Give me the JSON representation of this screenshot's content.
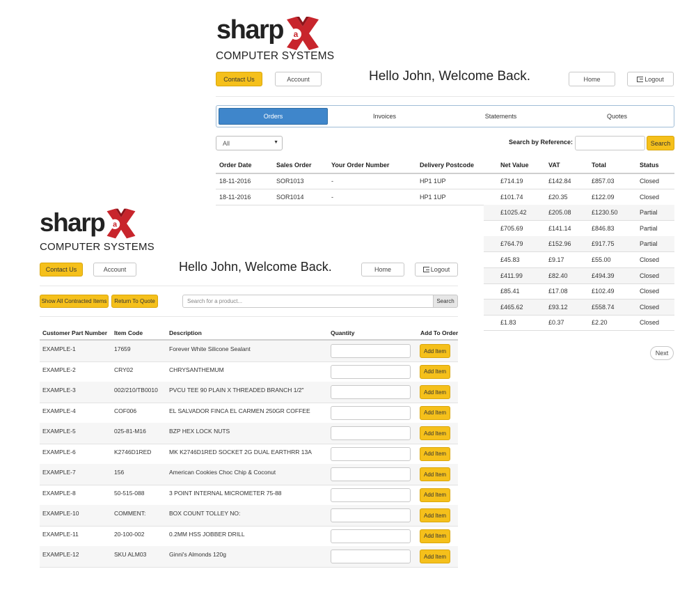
{
  "brand": {
    "word": "sharp",
    "small_letter": "a",
    "big_letter": "X",
    "subtitle": "COMPUTER SYSTEMS",
    "colors": {
      "red": "#c8252c",
      "dark_red": "#8d141a"
    }
  },
  "colors": {
    "accent_yellow": "#f5c01b",
    "tab_blue": "#3f86cb"
  },
  "orders_screen": {
    "contact_label": "Contact Us",
    "account_label": "Account",
    "greeting": "Hello John, Welcome Back.",
    "home_label": "Home",
    "logout_label": "Logout",
    "tabs": [
      {
        "label": "Orders",
        "active": true
      },
      {
        "label": "Invoices",
        "active": false
      },
      {
        "label": "Statements",
        "active": false
      },
      {
        "label": "Quotes",
        "active": false
      }
    ],
    "status_filter": "All",
    "search_ref_label": "Search by Reference:",
    "search_button": "Search",
    "columns": [
      "Order Date",
      "Sales Order",
      "Your Order Number",
      "Delivery Postcode",
      "Net Value",
      "VAT",
      "Total",
      "Status"
    ],
    "rows": [
      {
        "date": "18-11-2016",
        "sales_order": "SOR1013",
        "your_order": "-",
        "postcode": "HP1 1UP",
        "net": "£714.19",
        "vat": "£142.84",
        "total": "£857.03",
        "status": "Closed"
      },
      {
        "date": "18-11-2016",
        "sales_order": "SOR1014",
        "your_order": "-",
        "postcode": "HP1 1UP",
        "net": "£101.74",
        "vat": "£20.35",
        "total": "£122.09",
        "status": "Closed"
      },
      {
        "date": "",
        "sales_order": "",
        "your_order": "",
        "postcode": "",
        "net": "£1025.42",
        "vat": "£205.08",
        "total": "£1230.50",
        "status": "Partial"
      },
      {
        "date": "",
        "sales_order": "",
        "your_order": "",
        "postcode": "",
        "net": "£705.69",
        "vat": "£141.14",
        "total": "£846.83",
        "status": "Partial"
      },
      {
        "date": "",
        "sales_order": "",
        "your_order": "",
        "postcode": "",
        "net": "£764.79",
        "vat": "£152.96",
        "total": "£917.75",
        "status": "Partial"
      },
      {
        "date": "",
        "sales_order": "",
        "your_order": "",
        "postcode": "",
        "net": "£45.83",
        "vat": "£9.17",
        "total": "£55.00",
        "status": "Closed"
      },
      {
        "date": "",
        "sales_order": "",
        "your_order": "",
        "postcode": "",
        "net": "£411.99",
        "vat": "£82.40",
        "total": "£494.39",
        "status": "Closed"
      },
      {
        "date": "",
        "sales_order": "",
        "your_order": "",
        "postcode": "",
        "net": "£85.41",
        "vat": "£17.08",
        "total": "£102.49",
        "status": "Closed"
      },
      {
        "date": "",
        "sales_order": "",
        "your_order": "",
        "postcode": "",
        "net": "£465.62",
        "vat": "£93.12",
        "total": "£558.74",
        "status": "Closed"
      },
      {
        "date": "",
        "sales_order": "",
        "your_order": "",
        "postcode": "",
        "net": "£1.83",
        "vat": "£0.37",
        "total": "£2.20",
        "status": "Closed"
      }
    ],
    "next_label": "Next"
  },
  "products_screen": {
    "contact_label": "Contact Us",
    "account_label": "Account",
    "greeting": "Hello John, Welcome Back.",
    "home_label": "Home",
    "logout_label": "Logout",
    "show_all_label": "Show All Contracted Items",
    "return_quote_label": "Return To Quote",
    "search_placeholder": "Search for a product...",
    "search_button": "Search",
    "columns": [
      "Customer Part Number",
      "Item Code",
      "Description",
      "Quantity",
      "Add To Order"
    ],
    "add_label": "Add Item",
    "rows": [
      {
        "part": "EXAMPLE-1",
        "code": "17659",
        "desc": "Forever White Silicone Sealant"
      },
      {
        "part": "EXAMPLE-2",
        "code": "CRY02",
        "desc": "CHRYSANTHEMUM"
      },
      {
        "part": "EXAMPLE-3",
        "code": "002/210/TB0010",
        "desc": "PVCU TEE 90 PLAIN X THREADED BRANCH 1/2\""
      },
      {
        "part": "EXAMPLE-4",
        "code": "COF006",
        "desc": "EL SALVADOR FINCA EL CARMEN 250GR COFFEE"
      },
      {
        "part": "EXAMPLE-5",
        "code": "025-81-M16",
        "desc": "BZP HEX LOCK NUTS"
      },
      {
        "part": "EXAMPLE-6",
        "code": "K2746D1RED",
        "desc": "MK K2746D1RED SOCKET 2G DUAL EARTHRR 13A"
      },
      {
        "part": "EXAMPLE-7",
        "code": "156",
        "desc": "American Cookies Choc Chip & Coconut"
      },
      {
        "part": "EXAMPLE-8",
        "code": "50-515-088",
        "desc": "3 POINT INTERNAL MICROMETER 75-88"
      },
      {
        "part": "EXAMPLE-10",
        "code": "COMMENT:",
        "desc": "BOX COUNT TOLLEY NO:"
      },
      {
        "part": "EXAMPLE-11",
        "code": "20-100-002",
        "desc": "0.2MM HSS JOBBER DRILL"
      },
      {
        "part": "EXAMPLE-12",
        "code": "SKU ALM03",
        "desc": "Ginni's Almonds 120g"
      }
    ]
  }
}
